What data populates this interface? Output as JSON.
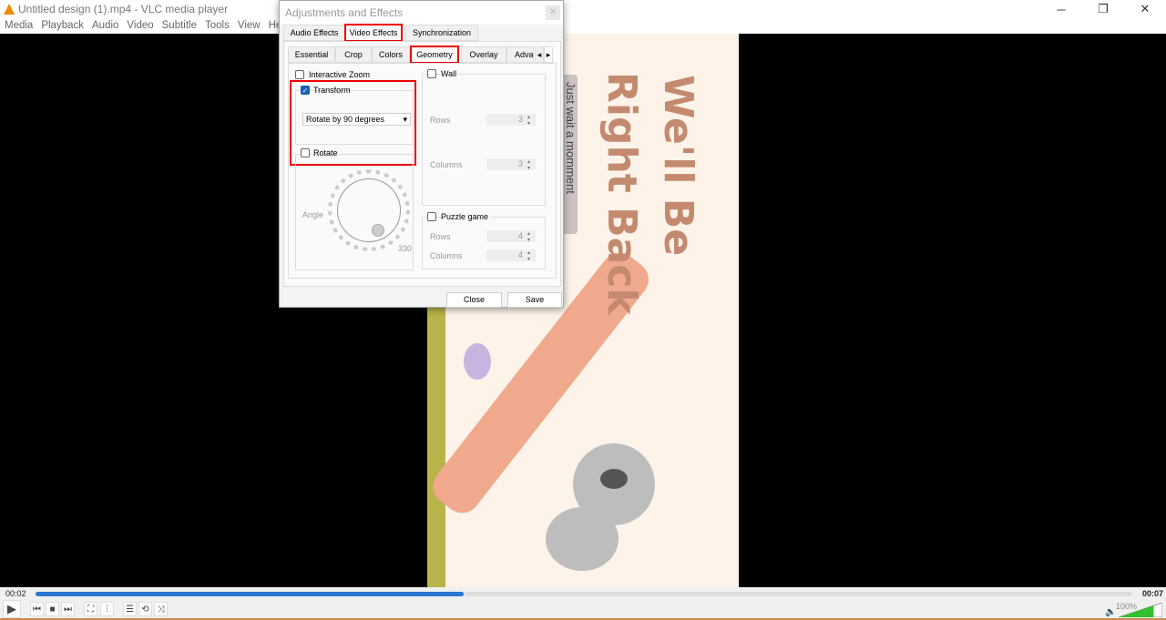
{
  "window": {
    "title": "Untitled design (1).mp4 - VLC media player"
  },
  "menu": [
    "Media",
    "Playback",
    "Audio",
    "Video",
    "Subtitle",
    "Tools",
    "View",
    "Help"
  ],
  "video": {
    "line1": "We'll Be",
    "line2": "Right Back",
    "note": "Just wait a momment"
  },
  "dialog": {
    "title": "Adjustments and Effects",
    "tabs": [
      "Audio Effects",
      "Video Effects",
      "Synchronization"
    ],
    "subtabs": [
      "Essential",
      "Crop",
      "Colors",
      "Geometry",
      "Overlay",
      "Adva"
    ],
    "interactive_zoom": "Interactive Zoom",
    "transform": "Transform",
    "transform_value": "Rotate by 90 degrees",
    "rotate": "Rotate",
    "angle_label": "Angle",
    "angle_value": "330",
    "wall": "Wall",
    "rows": "Rows",
    "columns": "Columns",
    "wall_rows": "3",
    "wall_columns": "3",
    "puzzle": "Puzzle game",
    "puzzle_rows": "4",
    "puzzle_columns": "4",
    "close": "Close",
    "save": "Save"
  },
  "player": {
    "elapsed": "00:02",
    "total": "00:07",
    "progress_percent": 39,
    "volume": "100%",
    "volume_level": 100
  }
}
